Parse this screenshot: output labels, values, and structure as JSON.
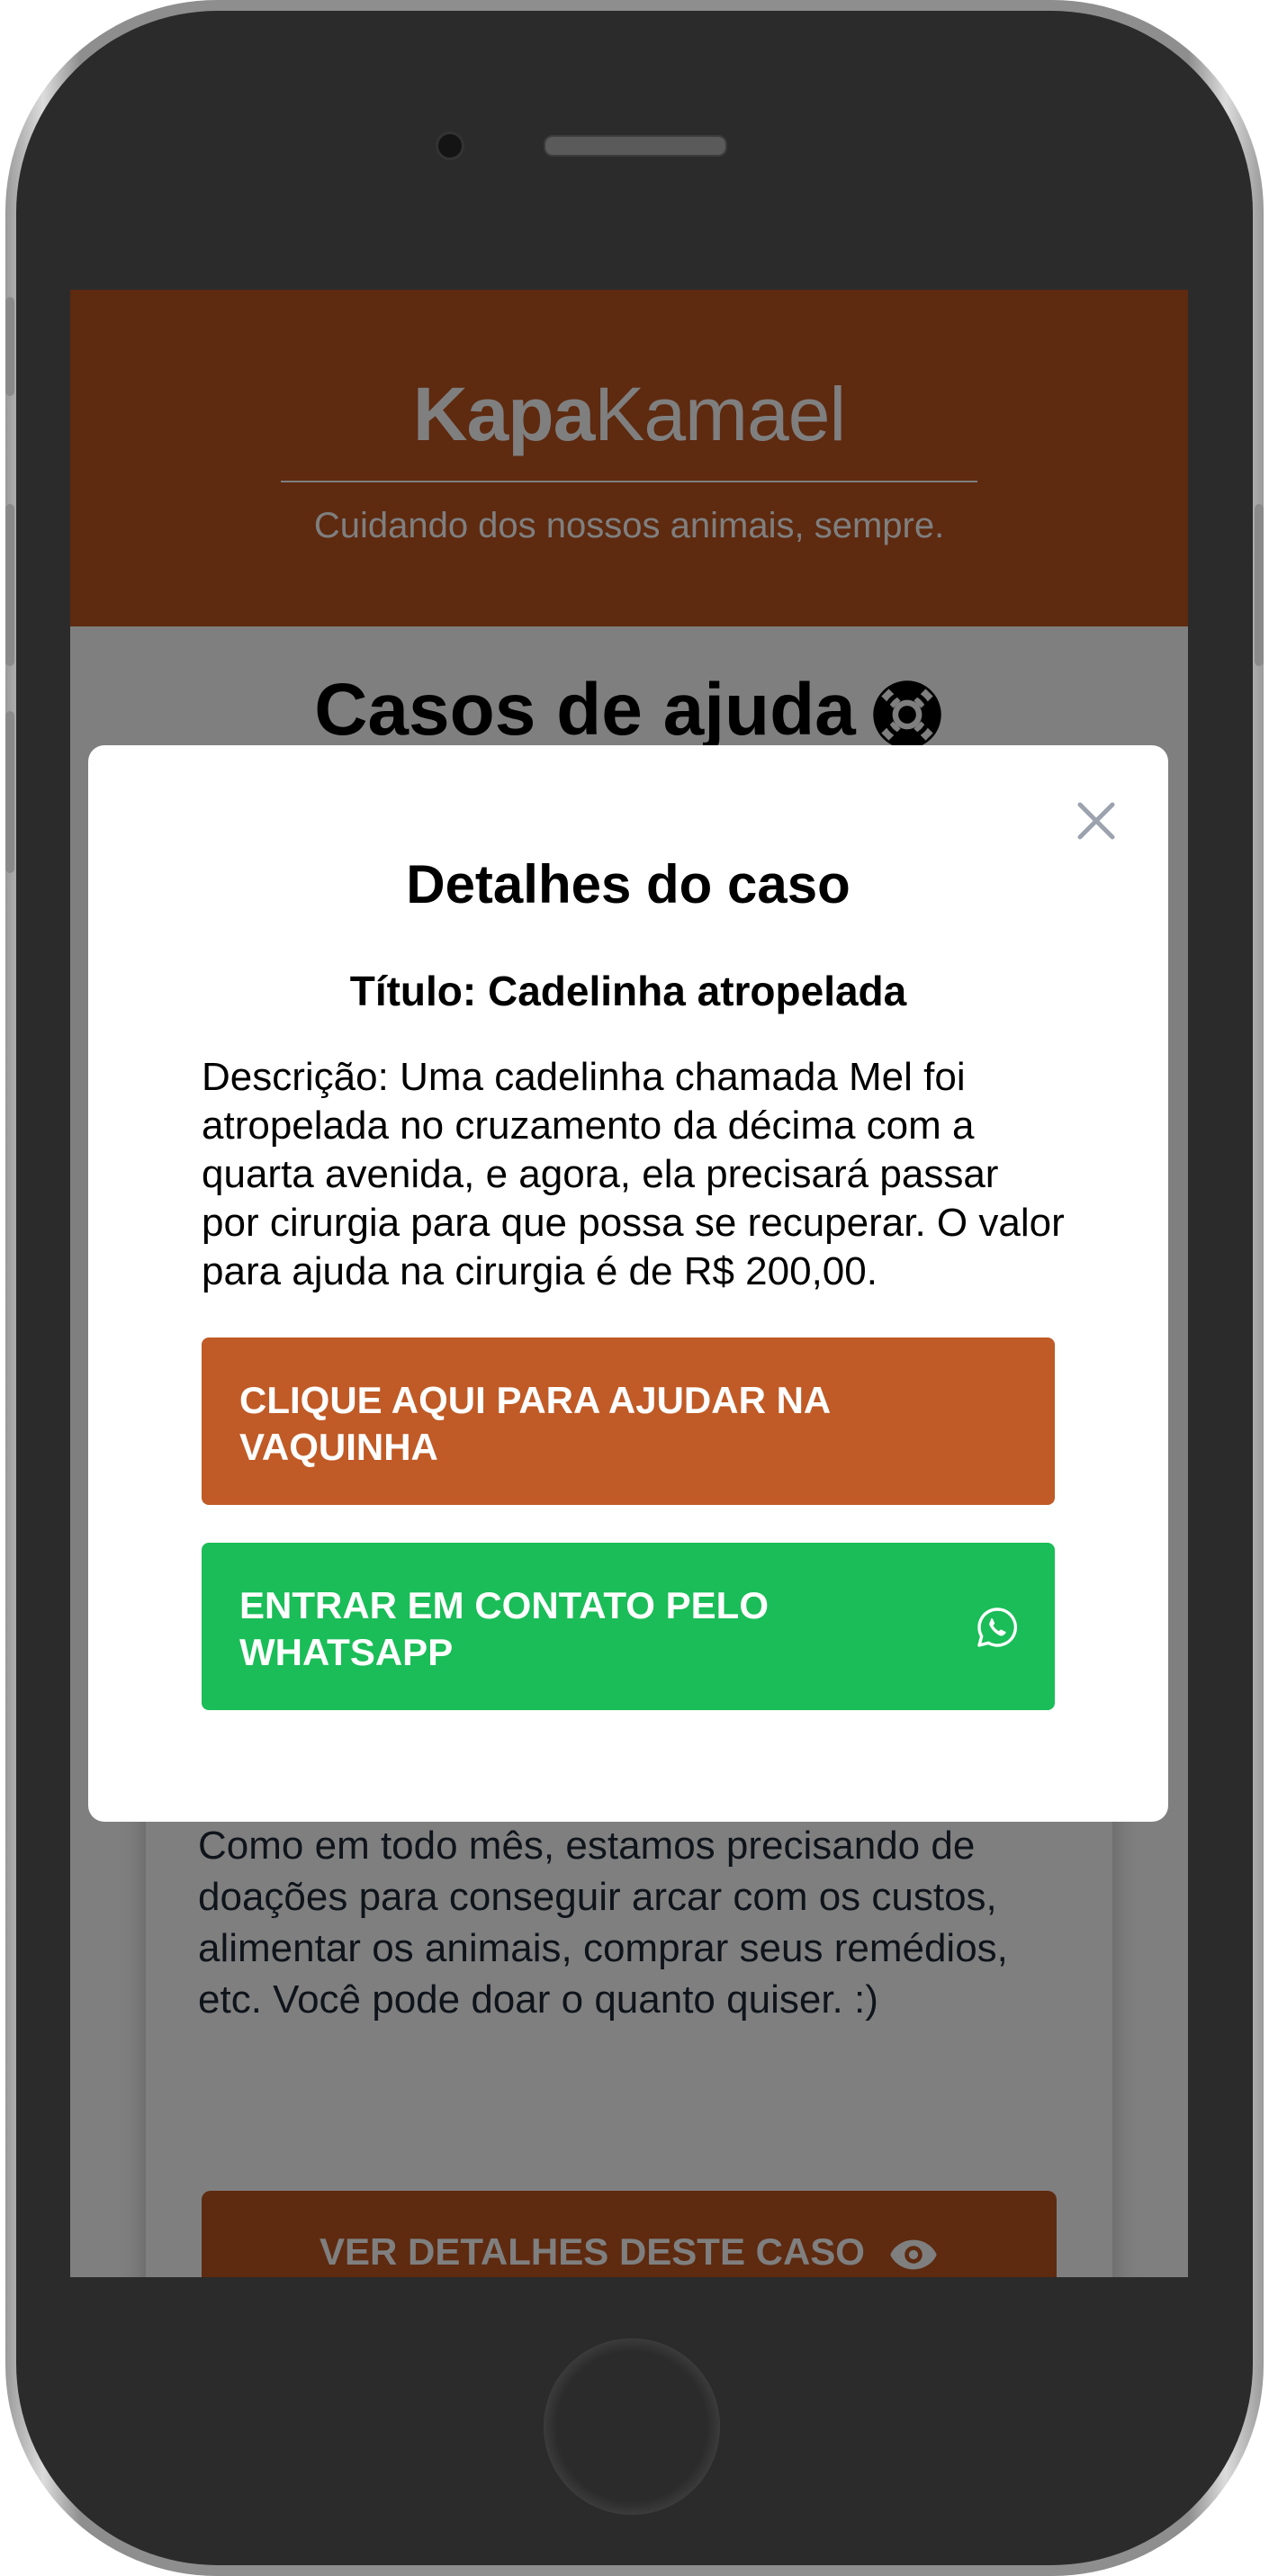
{
  "brand": {
    "name_bold": "Kapa",
    "name_light": "Kamael",
    "tagline": "Cuidando dos nossos animais, sempre."
  },
  "page": {
    "title": "Casos de ajuda",
    "title_icon": "lifebuoy-icon"
  },
  "background_case": {
    "description": "Como em todo mês, estamos precisando de doações para conseguir arcar com os custos, alimentar os animais, comprar seus remédios, etc. Você pode doar o quanto quiser. :)",
    "button_label": "VER DETALHES DESTE CASO",
    "button_icon": "eye-icon"
  },
  "modal": {
    "heading": "Detalhes do caso",
    "case_title": "Título: Cadelinha atropelada",
    "description": "Descrição: Uma cadelinha chamada Mel foi atropelada no cruzamento da décima com a quarta avenida, e agora, ela precisará passar por cirurgia para que possa se recuperar. O valor para ajuda na cirurgia é de R$ 200,00.",
    "donate_button": "CLIQUE AQUI PARA AJUDAR NA VAQUINHA",
    "whatsapp_button": "ENTRAR EM CONTATO PELO WHATSAPP",
    "close_icon": "close-icon",
    "whatsapp_icon": "whatsapp-icon"
  },
  "colors": {
    "brand_primary": "#bc5520",
    "donate_button": "#c05a26",
    "whatsapp_button": "#1abd57",
    "overlay": "rgba(0,0,0,0.5)"
  }
}
